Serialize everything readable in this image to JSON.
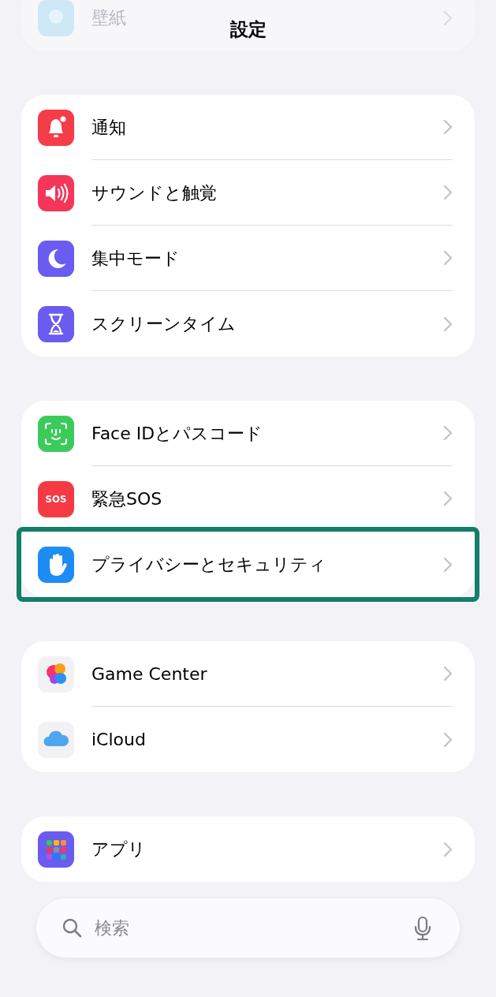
{
  "title": "設定",
  "groups": [
    {
      "cut_top": true,
      "rows": [
        {
          "kind": "wallpaper",
          "label": "壁紙",
          "highlighted": false
        }
      ]
    },
    {
      "rows": [
        {
          "kind": "bell",
          "label": "通知",
          "highlighted": false
        },
        {
          "kind": "speaker",
          "label": "サウンドと触覚",
          "highlighted": false
        },
        {
          "kind": "moon",
          "label": "集中モード",
          "highlighted": false
        },
        {
          "kind": "hourglass",
          "label": "スクリーンタイム",
          "highlighted": false
        }
      ]
    },
    {
      "rows": [
        {
          "kind": "face",
          "label": "Face IDとパスコード",
          "highlighted": false
        },
        {
          "kind": "sos",
          "label": "緊急SOS",
          "icon_text": "SOS",
          "highlighted": false
        },
        {
          "kind": "hand",
          "label": "プライバシーとセキュリティ",
          "highlighted": true
        }
      ]
    },
    {
      "rows": [
        {
          "kind": "bubbles",
          "label": "Game Center",
          "highlighted": false
        },
        {
          "kind": "cloud",
          "label": "iCloud",
          "highlighted": false
        }
      ]
    },
    {
      "rows": [
        {
          "kind": "grid",
          "label": "アプリ",
          "highlighted": false
        }
      ]
    }
  ],
  "search": {
    "placeholder": "検索"
  }
}
